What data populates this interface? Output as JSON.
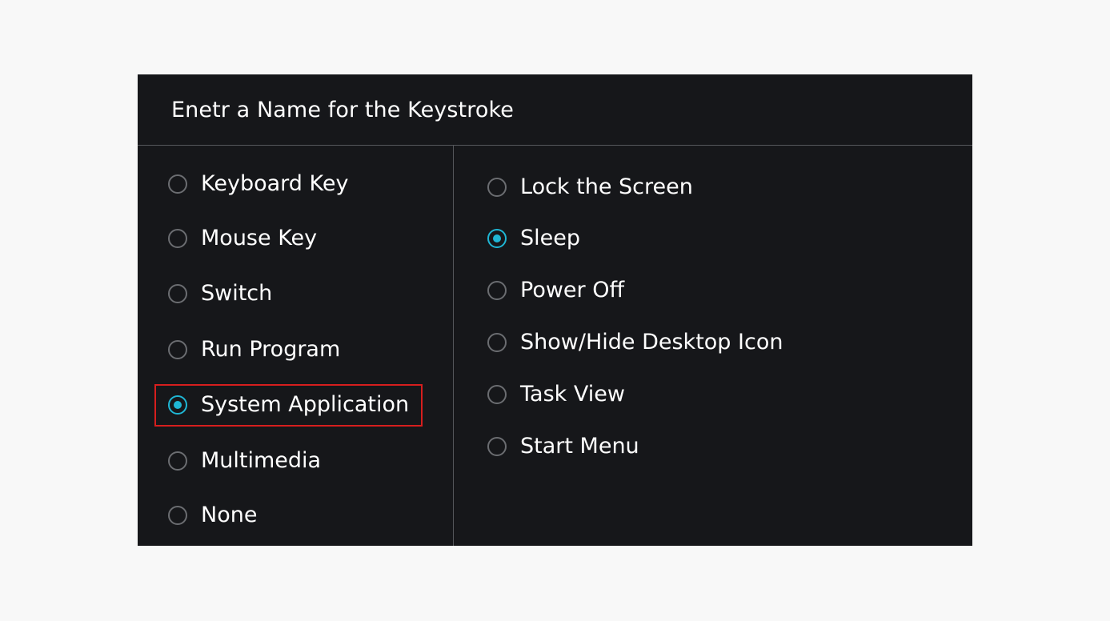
{
  "dialog": {
    "title": "Enetr a Name for the Keystroke"
  },
  "left_options": [
    {
      "label": "Keyboard Key",
      "checked": false
    },
    {
      "label": "Mouse Key",
      "checked": false
    },
    {
      "label": "Switch",
      "checked": false
    },
    {
      "label": "Run Program",
      "checked": false
    },
    {
      "label": "System Application",
      "checked": true
    },
    {
      "label": "Multimedia",
      "checked": false
    },
    {
      "label": "None",
      "checked": false
    }
  ],
  "right_options": [
    {
      "label": "Lock the Screen",
      "checked": false
    },
    {
      "label": "Sleep",
      "checked": true
    },
    {
      "label": "Power Off",
      "checked": false
    },
    {
      "label": "Show/Hide Desktop Icon",
      "checked": false
    },
    {
      "label": "Task View",
      "checked": false
    },
    {
      "label": "Start Menu",
      "checked": false
    }
  ],
  "colors": {
    "background": "#f8f8f8",
    "dialog_background": "#16171a",
    "accent": "#1fb6d4",
    "highlight": "#d61e1e",
    "radio_border": "#6b6d71",
    "divider": "#55575b"
  }
}
